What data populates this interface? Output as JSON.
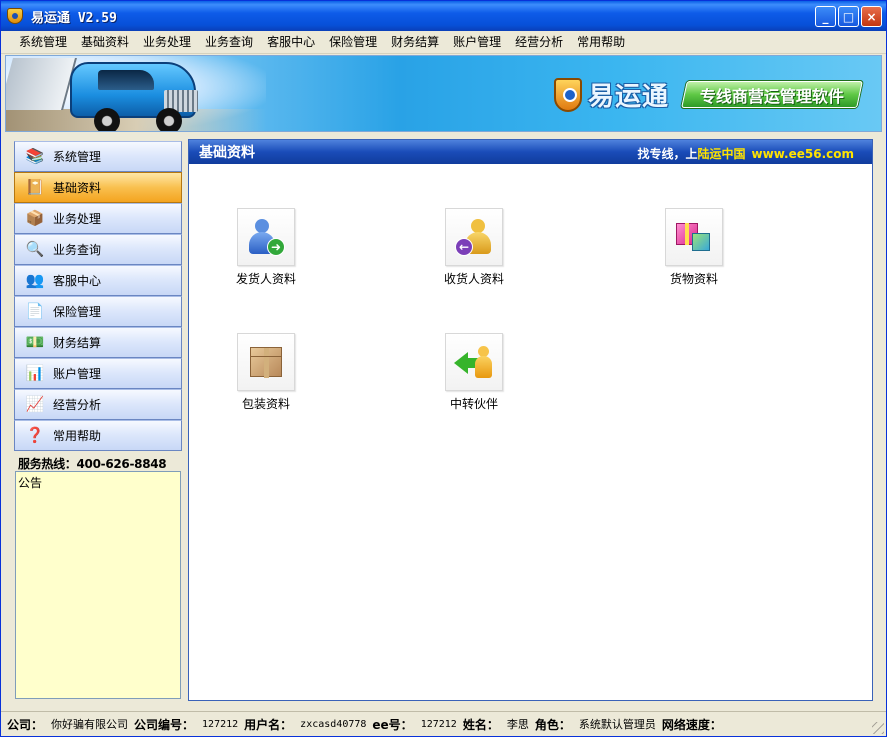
{
  "window": {
    "title": "易运通 V2.59",
    "buttons": {
      "minimize": "_",
      "maximize": "□",
      "close": "×"
    }
  },
  "menu": [
    "系统管理",
    "基础资料",
    "业务处理",
    "业务查询",
    "客服中心",
    "保险管理",
    "财务结算",
    "账户管理",
    "经营分析",
    "常用帮助"
  ],
  "banner": {
    "logo_text": "易运通",
    "slogan": "专线商营运管理软件"
  },
  "sidebar": {
    "items": [
      {
        "label": "系统管理",
        "icon": "books-icon",
        "glyph": "📚",
        "active": false
      },
      {
        "label": "基础资料",
        "icon": "book-icon",
        "glyph": "📔",
        "active": true
      },
      {
        "label": "业务处理",
        "icon": "package-stack-icon",
        "glyph": "📦",
        "active": false
      },
      {
        "label": "业务查询",
        "icon": "magnifier-icon",
        "glyph": "🔍",
        "active": false
      },
      {
        "label": "客服中心",
        "icon": "people-icon",
        "glyph": "👥",
        "active": false
      },
      {
        "label": "保险管理",
        "icon": "document-icon",
        "glyph": "📄",
        "active": false
      },
      {
        "label": "财务结算",
        "icon": "money-icon",
        "glyph": "💵",
        "active": false
      },
      {
        "label": "账户管理",
        "icon": "account-chart-icon",
        "glyph": "📊",
        "active": false
      },
      {
        "label": "经营分析",
        "icon": "analysis-icon",
        "glyph": "📈",
        "active": false
      },
      {
        "label": "常用帮助",
        "icon": "help-icon",
        "glyph": "❓",
        "active": false
      }
    ],
    "hotline": "服务热线：400-626-8848",
    "notice_label": "公告"
  },
  "content": {
    "title": "基础资料",
    "promo_prefix": "找专线，上",
    "promo_brand": "陆运中国",
    "promo_url": "www.ee56.com",
    "tiles": [
      {
        "label": "发货人资料",
        "icon": "shipper-icon"
      },
      {
        "label": "收货人资料",
        "icon": "consignee-icon"
      },
      {
        "label": "货物资料",
        "icon": "goods-gift-icon"
      },
      {
        "label": "包装资料",
        "icon": "packaging-box-icon"
      },
      {
        "label": "中转伙伴",
        "icon": "transfer-partner-icon"
      }
    ]
  },
  "status": {
    "company_label": "公司：",
    "company": "你好骗有限公司",
    "company_no_label": "公司编号：",
    "company_no": "127212",
    "username_label": "用户名：",
    "username": "zxcasd40778",
    "ee_label": "ee号：",
    "ee_no": "127212",
    "name_label": "姓名：",
    "name": "李思",
    "role_label": "角色：",
    "role": "系统默认管理员",
    "speed_label": "网络速度："
  },
  "colors": {
    "titlebar": "#0750d8",
    "active_nav": "#f9c04f",
    "content_header": "#1a4cb8",
    "promo_highlight": "#ffe400",
    "notice_bg": "#ffffcc"
  }
}
